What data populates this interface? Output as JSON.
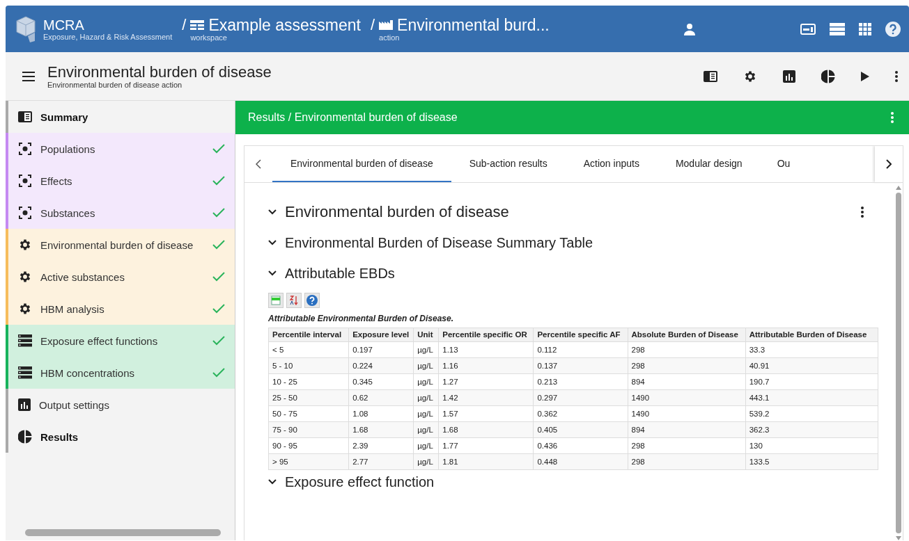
{
  "header": {
    "app_name": "MCRA",
    "app_subtitle": "Exposure, Hazard & Risk Assessment",
    "breadcrumbs": [
      {
        "separator": "/",
        "title": "Example assessment",
        "subtitle": "workspace",
        "kind": "workspace"
      },
      {
        "separator": "/",
        "title": "Environmental burd...",
        "subtitle": "action",
        "kind": "action"
      }
    ]
  },
  "toolbar": {
    "title": "Environmental burden of disease",
    "subtitle": "Environmental burden of disease action"
  },
  "sidebar": {
    "items": [
      {
        "label": "Summary",
        "kind": "summary",
        "color": "#aaaaaa",
        "checked": false,
        "selected": true
      },
      {
        "label": "Populations",
        "kind": "data",
        "color": "#c58af2",
        "checked": true,
        "selected": false
      },
      {
        "label": "Effects",
        "kind": "data",
        "color": "#c58af2",
        "checked": true,
        "selected": false
      },
      {
        "label": "Substances",
        "kind": "data",
        "color": "#c58af2",
        "checked": true,
        "selected": false
      },
      {
        "label": "Environmental burden of disease",
        "kind": "calculation",
        "color": "#f6bd5c",
        "checked": true,
        "selected": false
      },
      {
        "label": "Active substances",
        "kind": "calculation",
        "color": "#f6bd5c",
        "checked": true,
        "selected": false
      },
      {
        "label": "HBM analysis",
        "kind": "calculation",
        "color": "#f6bd5c",
        "checked": true,
        "selected": false
      },
      {
        "label": "Exposure effect functions",
        "kind": "module",
        "color": "#18b35c",
        "checked": true,
        "selected": false
      },
      {
        "label": "HBM concentrations",
        "kind": "module",
        "color": "#18b35c",
        "checked": true,
        "selected": false
      },
      {
        "label": "Output settings",
        "kind": "output",
        "color": "#aaaaaa",
        "checked": false,
        "selected": false
      },
      {
        "label": "Results",
        "kind": "results",
        "color": "#aaaaaa",
        "checked": false,
        "selected": true
      }
    ]
  },
  "results_bar": {
    "title": "Results / Environmental burden of disease"
  },
  "tabs": [
    {
      "label": "Environmental burden of disease",
      "selected": true
    },
    {
      "label": "Sub-action results",
      "selected": false
    },
    {
      "label": "Action inputs",
      "selected": false
    },
    {
      "label": "Modular design",
      "selected": false
    },
    {
      "label": "Ou",
      "selected": false
    }
  ],
  "sections": [
    {
      "title": "Environmental burden of disease",
      "expanded": true,
      "kind": "main"
    },
    {
      "title": "Environmental Burden of Disease Summary Table",
      "expanded": true,
      "kind": "sub"
    },
    {
      "title": "Attributable EBDs",
      "expanded": true,
      "kind": "sub"
    }
  ],
  "table": {
    "caption": "Attributable Environmental Burden of Disease.",
    "columns": [
      "Percentile interval",
      "Exposure level",
      "Unit",
      "Percentile specific OR",
      "Percentile specific AF",
      "Absolute Burden of Disease",
      "Attributable Burden of Disease"
    ],
    "rows": [
      [
        "< 5",
        "0.197",
        "µg/L",
        "1.13",
        "0.112",
        "298",
        "33.3"
      ],
      [
        "5 - 10",
        "0.224",
        "µg/L",
        "1.16",
        "0.137",
        "298",
        "40.91"
      ],
      [
        "10 - 25",
        "0.345",
        "µg/L",
        "1.27",
        "0.213",
        "894",
        "190.7"
      ],
      [
        "25 - 50",
        "0.62",
        "µg/L",
        "1.42",
        "0.297",
        "1490",
        "443.1"
      ],
      [
        "50 - 75",
        "1.08",
        "µg/L",
        "1.57",
        "0.362",
        "1490",
        "539.2"
      ],
      [
        "75 - 90",
        "1.68",
        "µg/L",
        "1.68",
        "0.405",
        "894",
        "362.3"
      ],
      [
        "90 - 95",
        "2.39",
        "µg/L",
        "1.77",
        "0.436",
        "298",
        "130"
      ],
      [
        "> 95",
        "2.77",
        "µg/L",
        "1.81",
        "0.448",
        "298",
        "133.5"
      ]
    ]
  },
  "next_section": {
    "title": "Exposure effect function"
  }
}
